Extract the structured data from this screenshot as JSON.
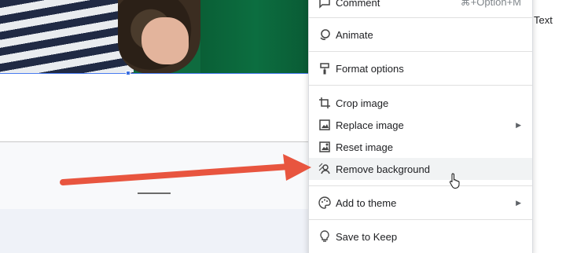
{
  "menu": {
    "items": [
      {
        "label": "Comment",
        "shortcut": "⌘+Option+M",
        "icon": "comment-icon"
      },
      {
        "label": "Animate",
        "icon": "animate-icon"
      },
      {
        "label": "Format options",
        "icon": "paint-roller-icon"
      },
      {
        "label": "Crop image",
        "icon": "crop-icon"
      },
      {
        "label": "Replace image",
        "icon": "replace-image-icon",
        "submenu": true
      },
      {
        "label": "Reset image",
        "icon": "reset-image-icon"
      },
      {
        "label": "Remove background",
        "icon": "remove-background-icon",
        "highlighted": true
      },
      {
        "label": "Add to theme",
        "icon": "palette-icon",
        "submenu": true
      },
      {
        "label": "Save to Keep",
        "icon": "lightbulb-icon"
      }
    ]
  },
  "side_label": "Text",
  "colors": {
    "annotation_arrow": "#e8553f",
    "selection": "#3b6fe0",
    "menu_highlight": "#f1f3f4"
  }
}
